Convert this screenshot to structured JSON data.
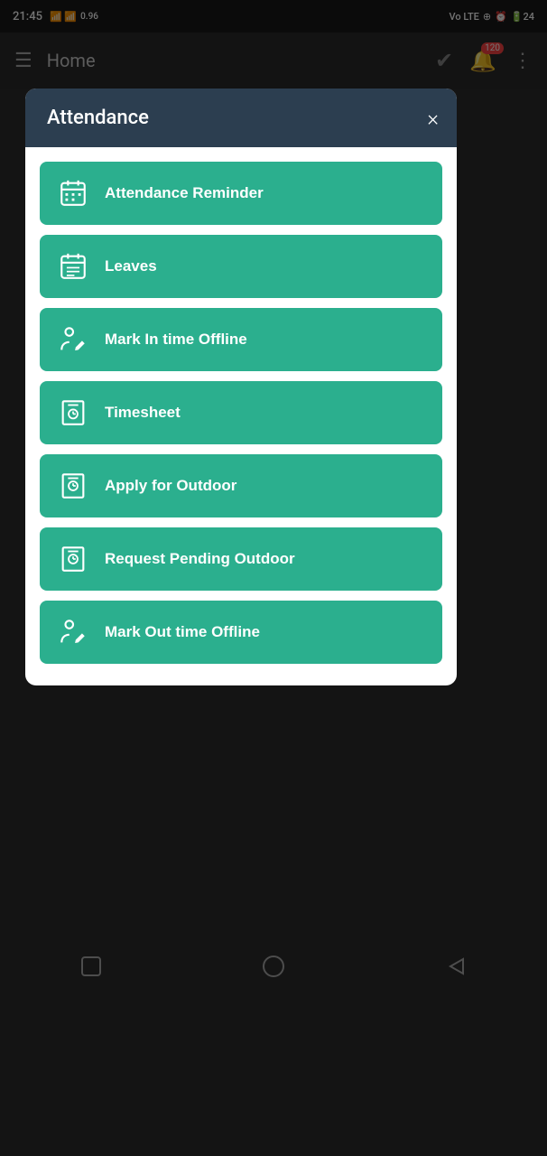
{
  "statusBar": {
    "time": "21:45",
    "badge": "120"
  },
  "appBar": {
    "title": "Home",
    "badgeCount": "120"
  },
  "dialog": {
    "title": "Attendance",
    "closeLabel": "×",
    "menuItems": [
      {
        "id": "attendance-reminder",
        "label": "Attendance Reminder",
        "icon": "calendar"
      },
      {
        "id": "leaves",
        "label": "Leaves",
        "icon": "calendar-grid"
      },
      {
        "id": "mark-in-offline",
        "label": "Mark In time Offline",
        "icon": "person-pen"
      },
      {
        "id": "timesheet",
        "label": "Timesheet",
        "icon": "timesheet"
      },
      {
        "id": "apply-outdoor",
        "label": "Apply for Outdoor",
        "icon": "outdoor"
      },
      {
        "id": "request-pending-outdoor",
        "label": "Request Pending Outdoor",
        "icon": "outdoor"
      },
      {
        "id": "mark-out-offline",
        "label": "Mark Out time Offline",
        "icon": "person-pen"
      }
    ]
  }
}
